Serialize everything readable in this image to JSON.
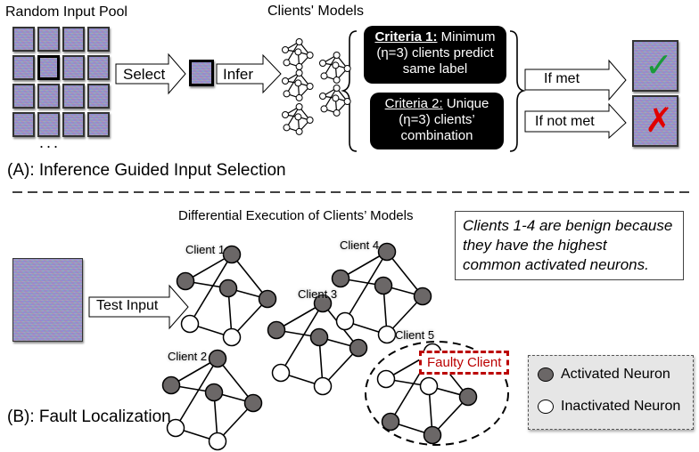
{
  "part_a": {
    "pool_title": "Random Input Pool",
    "pool_ellipsis": "...",
    "select_label": "Select",
    "infer_label": "Infer",
    "models_title": "Clients' Models",
    "criteria_1": {
      "heading": "Criteria 1:",
      "text_line1": " Minimum",
      "text_line2": "(η=3) clients predict",
      "text_line3": "same label"
    },
    "criteria_2": {
      "heading": "Criteria 2:",
      "text_line1": " Unique",
      "text_line2": "(η=3) clients’",
      "text_line3": "combination"
    },
    "if_met_label": "If met",
    "if_not_met_label": "If not met",
    "met_mark": "✓",
    "not_met_mark": "✗",
    "section_title": "(A): Inference Guided Input Selection"
  },
  "part_b": {
    "diff_title": "Differential Execution of Clients’ Models",
    "test_input_label": "Test Input",
    "note_lines": [
      "Clients 1-4 are benign because",
      "they have the highest",
      "common activated neurons."
    ],
    "clients": [
      {
        "label": "Client 1",
        "activated": [
          true,
          true,
          true,
          true,
          false,
          false
        ]
      },
      {
        "label": "Client 2",
        "activated": [
          true,
          true,
          true,
          true,
          false,
          false
        ]
      },
      {
        "label": "Client 3",
        "activated": [
          true,
          true,
          true,
          true,
          false,
          false
        ]
      },
      {
        "label": "Client 4",
        "activated": [
          true,
          true,
          true,
          true,
          false,
          false
        ]
      },
      {
        "label": "Client 5",
        "activated": [
          false,
          false,
          false,
          true,
          true,
          true
        ]
      }
    ],
    "faulty_label": "Faulty Client",
    "legend": {
      "activated": "Activated Neuron",
      "inactivated": "Inactivated Neuron"
    },
    "section_title": "(B): Fault Localization"
  },
  "colors": {
    "activated": "#6b6767",
    "inactivated": "#ffffff",
    "faulty": "#bb0000",
    "check": "#1a9a3a",
    "cross": "#e00000"
  }
}
